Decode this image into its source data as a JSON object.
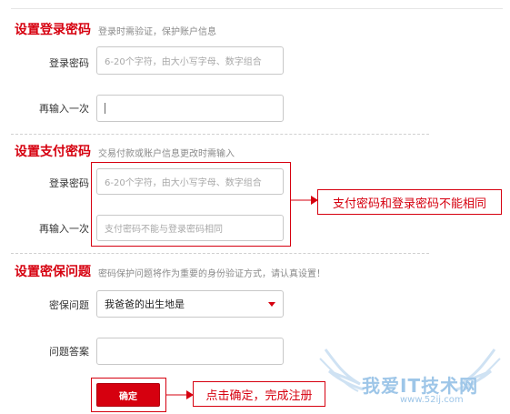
{
  "login_section": {
    "title": "设置登录密码",
    "desc": "登录时需验证，保护账户信息",
    "password_label": "登录密码",
    "password_placeholder": "6-20个字符，由大小写字母、数字组合",
    "confirm_label": "再输入一次"
  },
  "pay_section": {
    "title": "设置支付密码",
    "desc": "交易付款或账户信息更改时需输入",
    "password_label": "登录密码",
    "password_placeholder": "6-20个字符，由大小写字母、数字组合",
    "confirm_label": "再输入一次",
    "confirm_placeholder": "支付密码不能与登录密码相同",
    "callout": "支付密码和登录密码不能相同"
  },
  "security_section": {
    "title": "设置密保问题",
    "desc": "密码保护问题将作为重要的身份验证方式，请认真设置！",
    "question_label": "密保问题",
    "question_value": "我爸爸的出生地是",
    "answer_label": "问题答案"
  },
  "submit": {
    "label": "确定",
    "callout": "点击确定，完成注册"
  },
  "watermark": {
    "text": "我爱IT技术网",
    "url": "www.52ij.com"
  },
  "colors": {
    "accent": "#d6000f",
    "watermark": "#9ec6e8"
  }
}
